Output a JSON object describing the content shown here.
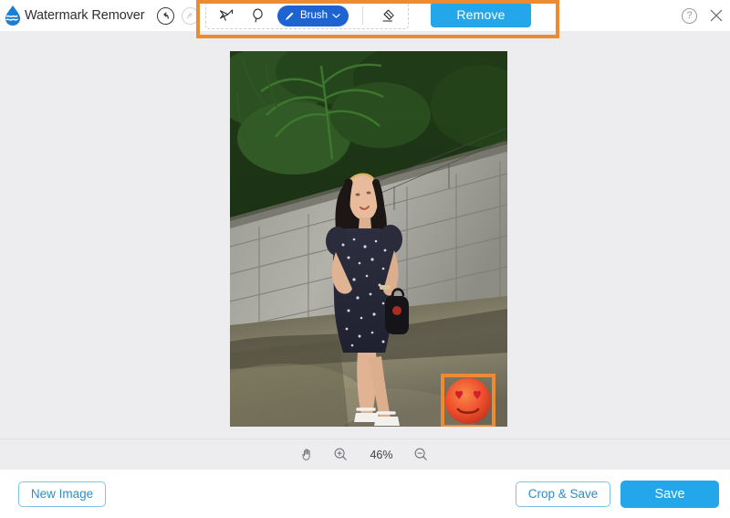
{
  "app": {
    "title": "Watermark Remover",
    "logo_icon": "water-drop-logo"
  },
  "header": {
    "undo": {
      "icon": "undo-arrow-icon",
      "label": "Undo",
      "enabled": true
    },
    "redo": {
      "icon": "redo-arrow-icon",
      "label": "Redo",
      "enabled": false
    },
    "help": {
      "icon": "help-circle-icon",
      "label": "?"
    },
    "close": {
      "icon": "close-x-icon",
      "label": "Close"
    }
  },
  "toolbar": {
    "polygon_tool": {
      "icon": "polygon-lasso-icon",
      "label": "Polygonal Lasso"
    },
    "lasso_tool": {
      "icon": "lasso-icon",
      "label": "Lasso"
    },
    "brush": {
      "icon": "brush-icon",
      "label": "Brush",
      "chevron": "chevron-down-icon",
      "active": true
    },
    "eraser": {
      "icon": "eraser-icon",
      "label": "Eraser"
    },
    "remove_label": "Remove",
    "highlight_color": "#ed8b33",
    "brush_color": "#1d63d1",
    "accent_color": "#23a6ea"
  },
  "canvas": {
    "photo_alt": "Woman in floral dress standing beside concrete block wall with palm trees",
    "selection": {
      "name": "emoji-watermark-selection",
      "highlight_color": "#ed8b33",
      "content": "heart-eyes-emoji"
    }
  },
  "zoombar": {
    "hand_tool": {
      "icon": "hand-icon",
      "label": "Pan"
    },
    "zoom_in": {
      "icon": "zoom-in-icon",
      "label": "Zoom in"
    },
    "zoom_level": "46%",
    "zoom_out": {
      "icon": "zoom-out-icon",
      "label": "Zoom out"
    }
  },
  "footer": {
    "new_image_label": "New Image",
    "crop_save_label": "Crop & Save",
    "save_label": "Save"
  }
}
